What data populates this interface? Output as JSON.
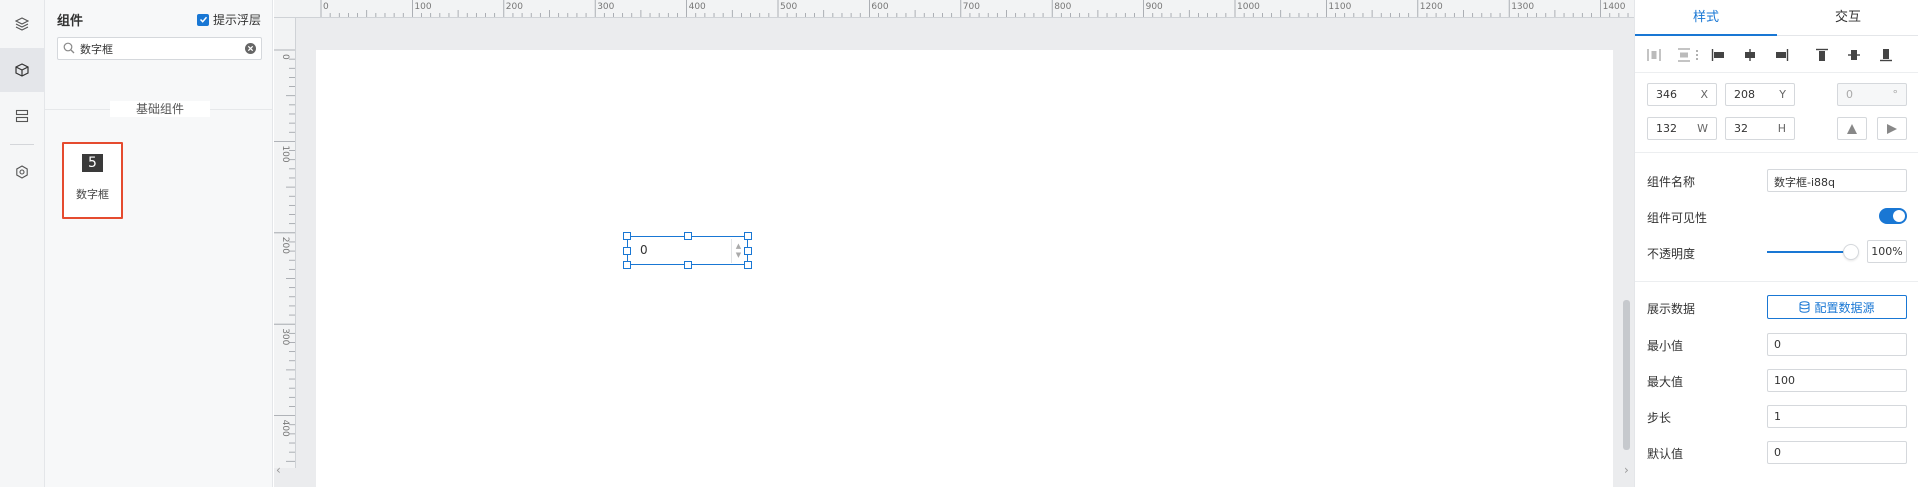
{
  "colors": {
    "accent": "#1977d4",
    "selection_border": "#e54b2f",
    "toggle_on": "#1977d4"
  },
  "rail": {
    "icons": [
      "layers-icon",
      "cube-icon",
      "outline-icon",
      "settings-icon"
    ],
    "active": "cube-icon"
  },
  "panel": {
    "title": "组件",
    "hint_label": "提示浮层",
    "hint_checked": true,
    "search": {
      "value": "数字框",
      "placeholder": ""
    },
    "group_title": "基础组件",
    "components": [
      {
        "icon_char": "5",
        "label": "数字框",
        "selected": true
      }
    ]
  },
  "ruler": {
    "top_labels": [
      "0",
      "100",
      "200",
      "300",
      "400",
      "500",
      "600",
      "700",
      "800",
      "900",
      "1000",
      "1100",
      "1200",
      "1300",
      "1400"
    ],
    "left_labels": [
      "0",
      "100",
      "200",
      "300",
      "400"
    ]
  },
  "widget": {
    "value": "0"
  },
  "props": {
    "tabs": {
      "style": "样式",
      "interact": "交互"
    },
    "geometry": {
      "x": "346",
      "x_unit": "X",
      "y": "208",
      "y_unit": "Y",
      "rotation": "0",
      "rotation_unit": "°",
      "w": "132",
      "w_unit": "W",
      "h": "32",
      "h_unit": "H"
    },
    "name_label": "组件名称",
    "name_value": "数字框-i88q",
    "visible_label": "组件可见性",
    "visible": true,
    "opacity_label": "不透明度",
    "opacity_value": "100%",
    "opacity": 1.0,
    "data_label": "展示数据",
    "data_button": "配置数据源",
    "min_label": "最小值",
    "min_value": "0",
    "max_label": "最大值",
    "max_value": "100",
    "step_label": "步长",
    "step_value": "1",
    "default_label": "默认值",
    "default_value": "0"
  }
}
